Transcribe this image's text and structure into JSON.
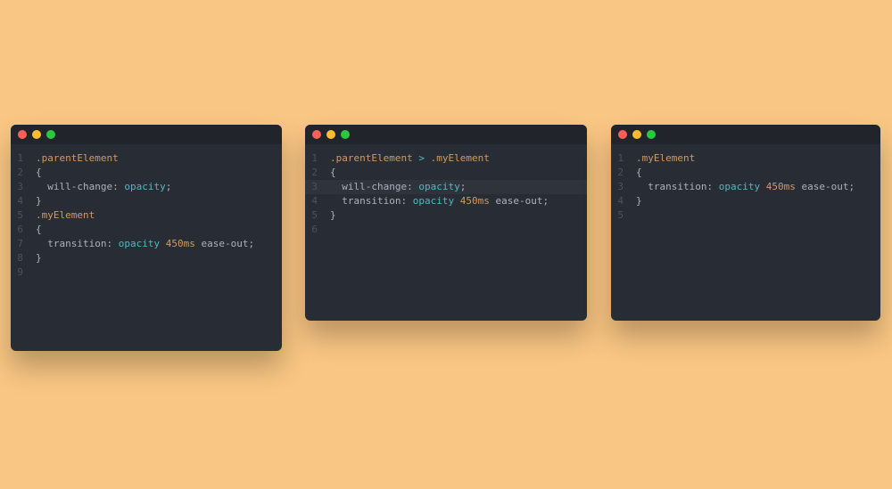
{
  "background": "#f9c683",
  "syntax_theme": "one-dark",
  "windows": [
    {
      "id": "w0",
      "traffic_lights": [
        "close",
        "minimize",
        "zoom"
      ],
      "line_count": 9,
      "highlight_line": null,
      "lines": [
        {
          "n": 1,
          "indent": 0,
          "tokens": [
            {
              "t": ".parentElement",
              "c": "sel"
            }
          ]
        },
        {
          "n": 2,
          "indent": 0,
          "tokens": [
            {
              "t": "{",
              "c": "punct"
            }
          ]
        },
        {
          "n": 3,
          "indent": 1,
          "tokens": [
            {
              "t": "will-change",
              "c": "prop"
            },
            {
              "t": ": ",
              "c": "punct"
            },
            {
              "t": "opacity",
              "c": "kw"
            },
            {
              "t": ";",
              "c": "punct"
            }
          ]
        },
        {
          "n": 4,
          "indent": 0,
          "tokens": [
            {
              "t": "}",
              "c": "punct"
            }
          ]
        },
        {
          "n": 5,
          "indent": 0,
          "tokens": [
            {
              "t": ".myElement",
              "c": "sel"
            }
          ]
        },
        {
          "n": 6,
          "indent": 0,
          "tokens": [
            {
              "t": "{",
              "c": "punct"
            }
          ]
        },
        {
          "n": 7,
          "indent": 1,
          "tokens": [
            {
              "t": "transition",
              "c": "prop"
            },
            {
              "t": ": ",
              "c": "punct"
            },
            {
              "t": "opacity ",
              "c": "kw"
            },
            {
              "t": "450ms",
              "c": "num"
            },
            {
              "t": " ease-out",
              "c": "prop"
            },
            {
              "t": ";",
              "c": "punct"
            }
          ]
        },
        {
          "n": 8,
          "indent": 0,
          "tokens": [
            {
              "t": "}",
              "c": "punct"
            }
          ]
        },
        {
          "n": 9,
          "indent": 0,
          "tokens": []
        }
      ]
    },
    {
      "id": "w1",
      "traffic_lights": [
        "close",
        "minimize",
        "zoom"
      ],
      "line_count": 6,
      "highlight_line": 3,
      "lines": [
        {
          "n": 1,
          "indent": 0,
          "tokens": [
            {
              "t": ".parentElement",
              "c": "sel"
            },
            {
              "t": " > ",
              "c": "kw"
            },
            {
              "t": ".myElement",
              "c": "sel"
            }
          ]
        },
        {
          "n": 2,
          "indent": 0,
          "tokens": [
            {
              "t": "{",
              "c": "punct"
            }
          ]
        },
        {
          "n": 3,
          "indent": 1,
          "tokens": [
            {
              "t": "will-change",
              "c": "prop"
            },
            {
              "t": ": ",
              "c": "punct"
            },
            {
              "t": "opacity",
              "c": "kw"
            },
            {
              "t": ";",
              "c": "punct"
            }
          ]
        },
        {
          "n": 4,
          "indent": 1,
          "tokens": [
            {
              "t": "transition",
              "c": "prop"
            },
            {
              "t": ": ",
              "c": "punct"
            },
            {
              "t": "opacity ",
              "c": "kw"
            },
            {
              "t": "450ms",
              "c": "num"
            },
            {
              "t": " ease-out",
              "c": "prop"
            },
            {
              "t": ";",
              "c": "punct"
            }
          ]
        },
        {
          "n": 5,
          "indent": 0,
          "tokens": [
            {
              "t": "}",
              "c": "punct"
            }
          ]
        },
        {
          "n": 6,
          "indent": 0,
          "tokens": []
        }
      ]
    },
    {
      "id": "w2",
      "traffic_lights": [
        "close",
        "minimize",
        "zoom"
      ],
      "line_count": 5,
      "highlight_line": null,
      "lines": [
        {
          "n": 1,
          "indent": 0,
          "tokens": [
            {
              "t": ".myElement",
              "c": "sel"
            }
          ]
        },
        {
          "n": 2,
          "indent": 0,
          "tokens": [
            {
              "t": "{",
              "c": "punct"
            }
          ]
        },
        {
          "n": 3,
          "indent": 1,
          "tokens": [
            {
              "t": "transition",
              "c": "prop"
            },
            {
              "t": ": ",
              "c": "punct"
            },
            {
              "t": "opacity ",
              "c": "kw"
            },
            {
              "t": "450ms",
              "c": "num"
            },
            {
              "t": " ease-out",
              "c": "prop"
            },
            {
              "t": ";",
              "c": "punct"
            }
          ]
        },
        {
          "n": 4,
          "indent": 0,
          "tokens": [
            {
              "t": "}",
              "c": "punct"
            }
          ]
        },
        {
          "n": 5,
          "indent": 0,
          "tokens": []
        }
      ]
    }
  ]
}
